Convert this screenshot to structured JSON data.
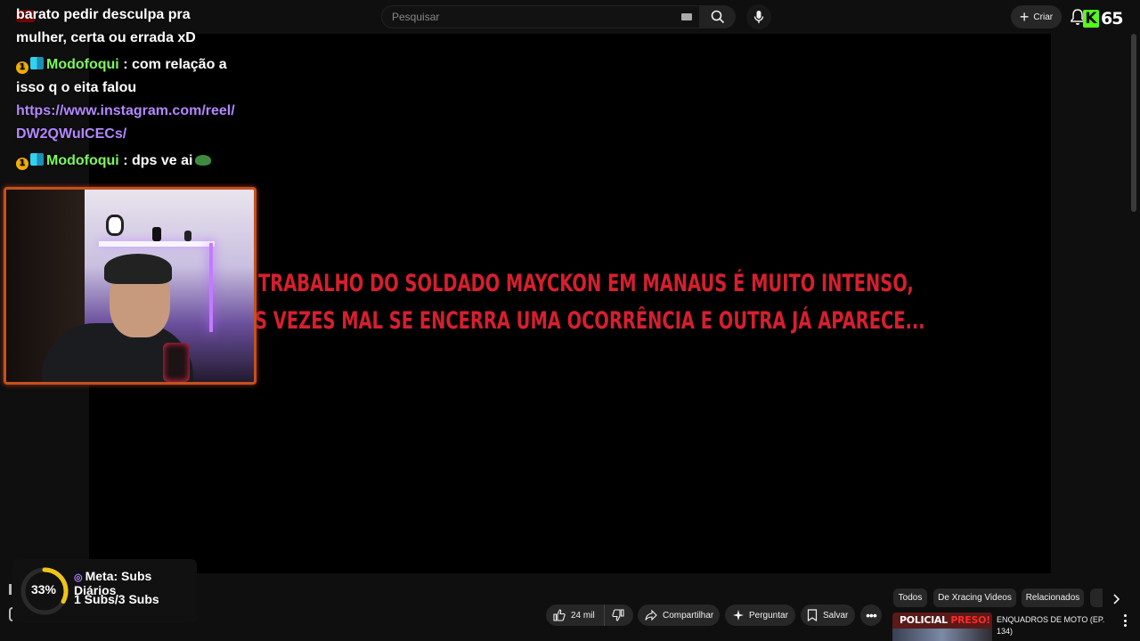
{
  "header": {
    "search_placeholder": "Pesquisar",
    "create_label": "Criar",
    "kick_count": "65"
  },
  "chat": {
    "partial_message": "barato pedir desculpa pra mulher, certa ou errada xD",
    "messages": [
      {
        "user": "Modofoqui",
        "text": " : com relação a isso q o eita falou",
        "link": "https://www.instagram.com/reel/DW2QWuICECs/"
      },
      {
        "user": "Modofoqui",
        "text": " : dps ve ai",
        "link": ""
      }
    ]
  },
  "video": {
    "caption_line1": "TRABALHO DO SOLDADO MAYCKON EM MANAUS É MUITO INTENSO,",
    "caption_line2": "S VEZES MAL SE ENCERRA UMA OCORRÊNCIA E OUTRA JÁ APARECE..."
  },
  "goal": {
    "percent_label": "33%",
    "progress": 0.33,
    "title": "Meta: Subs Diários",
    "count": "1 Subs/3 Subs"
  },
  "actions": {
    "likes": "24 mil",
    "share": "Compartilhar",
    "ask": "Perguntar",
    "save": "Salvar"
  },
  "chips": [
    "Todos",
    "De Xracing Videos",
    "Relacionados"
  ],
  "related": {
    "thumb_text_white": "POLICIAL ",
    "thumb_text_red": "PRESO!",
    "title": "ENQUADROS DE MOTO (EP. 134)"
  },
  "colors": {
    "chat_user": "#7cf85c",
    "chat_link": "#b388ff",
    "caption": "#d61f2e",
    "kick_green": "#53fc18",
    "goal_ring": "#f0c419"
  }
}
